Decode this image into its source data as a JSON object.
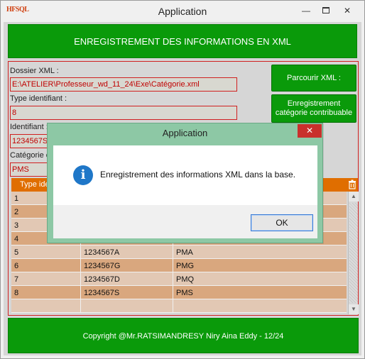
{
  "window": {
    "app_logo": "HFSQL",
    "title": "Application",
    "controls": {
      "minimize": "—",
      "close": "✕"
    }
  },
  "header": {
    "title": "ENREGISTREMENT DES INFORMATIONS EN XML"
  },
  "form": {
    "dossier_label": "Dossier XML :",
    "dossier_value": "E:\\ATELIER\\Professeur_wd_11_24\\Exe\\Catégorie.xml",
    "type_label": "Type identifiant :",
    "type_value": "8",
    "identifiant_label": "Identifiant :",
    "identifiant_value": "1234567S",
    "categorie_label": "Catégorie c",
    "categorie_value": "PMS",
    "browse_button": "Parcourir XML :",
    "save_button_line1": "Enregistrement",
    "save_button_line2": "catégorie contribuable"
  },
  "table": {
    "columns": [
      "Type ide",
      "",
      ""
    ],
    "trash_icon": "trash-icon",
    "rows": [
      {
        "type": "1",
        "identifiant": "",
        "categorie": ""
      },
      {
        "type": "2",
        "identifiant": "",
        "categorie": ""
      },
      {
        "type": "3",
        "identifiant": "",
        "categorie": ""
      },
      {
        "type": "4",
        "identifiant": "",
        "categorie": ""
      },
      {
        "type": "5",
        "identifiant": "1234567A",
        "categorie": "PMA"
      },
      {
        "type": "6",
        "identifiant": "1234567G",
        "categorie": "PMG"
      },
      {
        "type": "7",
        "identifiant": "1234567D",
        "categorie": "PMQ"
      },
      {
        "type": "8",
        "identifiant": "1234567S",
        "categorie": "PMS"
      },
      {
        "type": "",
        "identifiant": "",
        "categorie": ""
      }
    ]
  },
  "footer": {
    "text": "Copyright @Mr.RATSIMANDRESY Niry Aina Eddy - 12/24"
  },
  "dialog": {
    "title": "Application",
    "close": "✕",
    "icon": "info-icon",
    "message": "Enregistrement des informations XML dans la base.",
    "ok_button": "OK"
  },
  "colors": {
    "green": "#0a9a0a",
    "orange_header": "#e06e00",
    "row_dark": "#d9a77e",
    "row_light": "#e2c8b4",
    "field_border": "#d02020",
    "dialog_frame": "#8dc8a5",
    "info_blue": "#1f77c8"
  }
}
